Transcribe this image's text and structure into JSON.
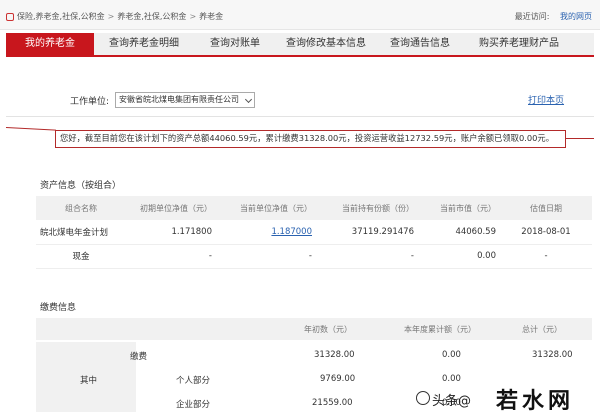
{
  "breadcrumb": [
    "保险,养老金,社保,公积金",
    "养老金,社保,公积金",
    "养老金"
  ],
  "visit": {
    "label": "最近访问:",
    "link": "我的网页"
  },
  "nav": {
    "tabs": [
      "我的养老金",
      "查询养老金明细",
      "查询对账单",
      "查询修改基本信息",
      "查询通告信息",
      "购买养老理财产品"
    ],
    "active_index": 0
  },
  "unit": {
    "label": "工作单位:",
    "value": "安徽省皖北煤电集团有限责任公司"
  },
  "print_label": "打印本页",
  "notice": "您好，截至目前您在该计划下的资产总额44060.59元，累计缴费31328.00元，投资运营收益12732.59元，账户余额已领取0.00元。",
  "asset": {
    "title": "资产信息（按组合）",
    "headers": [
      "组合名称",
      "初期单位净值（元）",
      "当前单位净值（元）",
      "当前持有份额（份）",
      "当前市值（元）",
      "估值日期"
    ],
    "rows": [
      [
        "皖北煤电年金计划",
        "1.171800",
        "1.187000",
        "37119.291476",
        "44060.59",
        "2018-08-01"
      ],
      [
        "现金",
        "-",
        "-",
        "-",
        "0.00",
        "-"
      ]
    ]
  },
  "contrib": {
    "title": "缴费信息",
    "headers": [
      "年初数（元）",
      "本年度累计额（元）",
      "总计（元）"
    ],
    "rows": [
      {
        "label": "缴费",
        "sub": "",
        "init": "31328.00",
        "year": "0.00",
        "total": "31328.00"
      },
      {
        "label": "其中",
        "sub": "个人部分",
        "init": "9769.00",
        "year": "0.00",
        "total": ""
      },
      {
        "label": "",
        "sub": "企业部分",
        "init": "21559.00",
        "year": "0.00",
        "total": ""
      }
    ]
  },
  "watermark": {
    "left": "头条@",
    "right": "若水网"
  }
}
